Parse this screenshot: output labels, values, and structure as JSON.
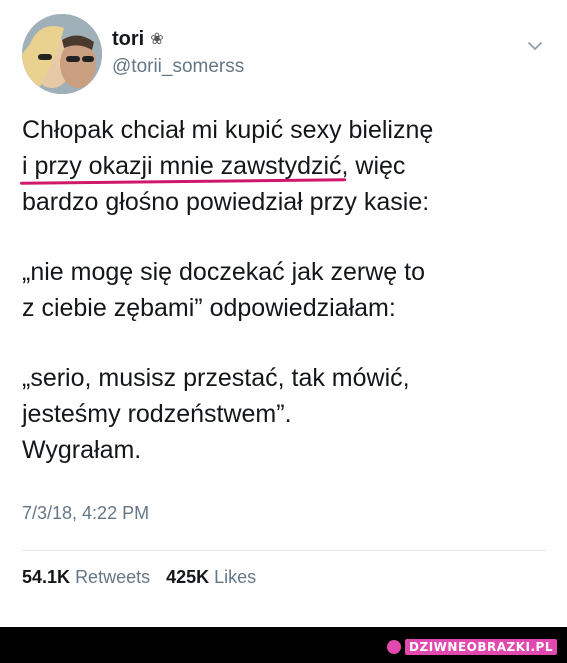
{
  "tweet": {
    "display_name": "tori",
    "name_icon": "flower-icon",
    "handle": "@torii_somerss",
    "menu_icon": "chevron-down-icon",
    "text": {
      "line1": "Chłopak chciał mi kupić sexy bieliznę",
      "line2_underlined": "i przy okazji mnie zawstydzić",
      "line2_rest": ", więc",
      "line3": "bardzo głośno powiedział przy kasie:",
      "line4": "„nie mogę się doczekać jak zerwę to",
      "line5": "z ciebie zębami” odpowiedziałam:",
      "line6": "„serio, musisz przestać, tak mówić,",
      "line7": "jesteśmy rodzeństwem”.",
      "line8": "Wygrałam."
    },
    "underline_color": "#d0186a",
    "timestamp": "7/3/18, 4:22 PM",
    "stats": {
      "retweets_count": "54.1K",
      "retweets_label": "Retweets",
      "likes_count": "425K",
      "likes_label": "Likes"
    }
  },
  "watermark": {
    "text": "DZIWNEOBRAZKI.PL",
    "accent_color": "#e04ab0"
  }
}
